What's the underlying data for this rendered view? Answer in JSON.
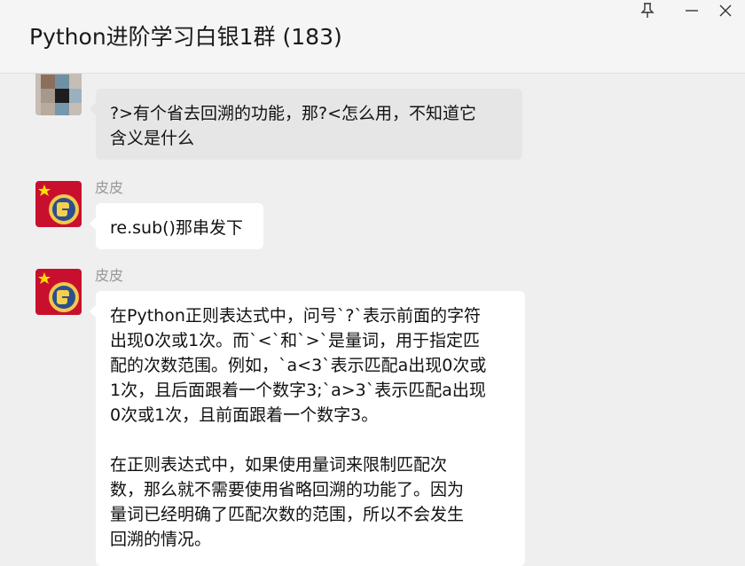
{
  "header": {
    "title": "Python进阶学习白银1群 (183)",
    "icons": [
      "pin-icon",
      "minimize-icon",
      "close-icon"
    ]
  },
  "messages": [
    {
      "sender": "",
      "avatar": "blurred-photo",
      "lines": [
        "?>有个省去回溯的功能，那?<怎么用，不知道它",
        "含义是什么"
      ]
    },
    {
      "sender": "皮皮",
      "avatar": "flag-python-logo",
      "lines": [
        "re.sub()那串发下"
      ]
    },
    {
      "sender": "皮皮",
      "avatar": "flag-python-logo",
      "paragraphs": [
        [
          "在Python正则表达式中，问号`?`表示前面的字符",
          "出现0次或1次。而`<`和`>`是量词，用于指定匹",
          "配的次数范围。例如，`a<3`表示匹配a出现0次或",
          "1次，且后面跟着一个数字3;`a>3`表示匹配a出现",
          "0次或1次，且前面跟着一个数字3。"
        ],
        [
          "在正则表达式中，如果使用量词来限制匹配次",
          "数，那么就不需要使用省略回溯的功能了。因为",
          "量词已经明确了匹配次数的范围，所以不会发生",
          "回溯的情况。"
        ]
      ]
    }
  ],
  "colors": {
    "background": "#efefef",
    "bubble_self": "#e6e6e6",
    "bubble_other": "#ffffff"
  }
}
